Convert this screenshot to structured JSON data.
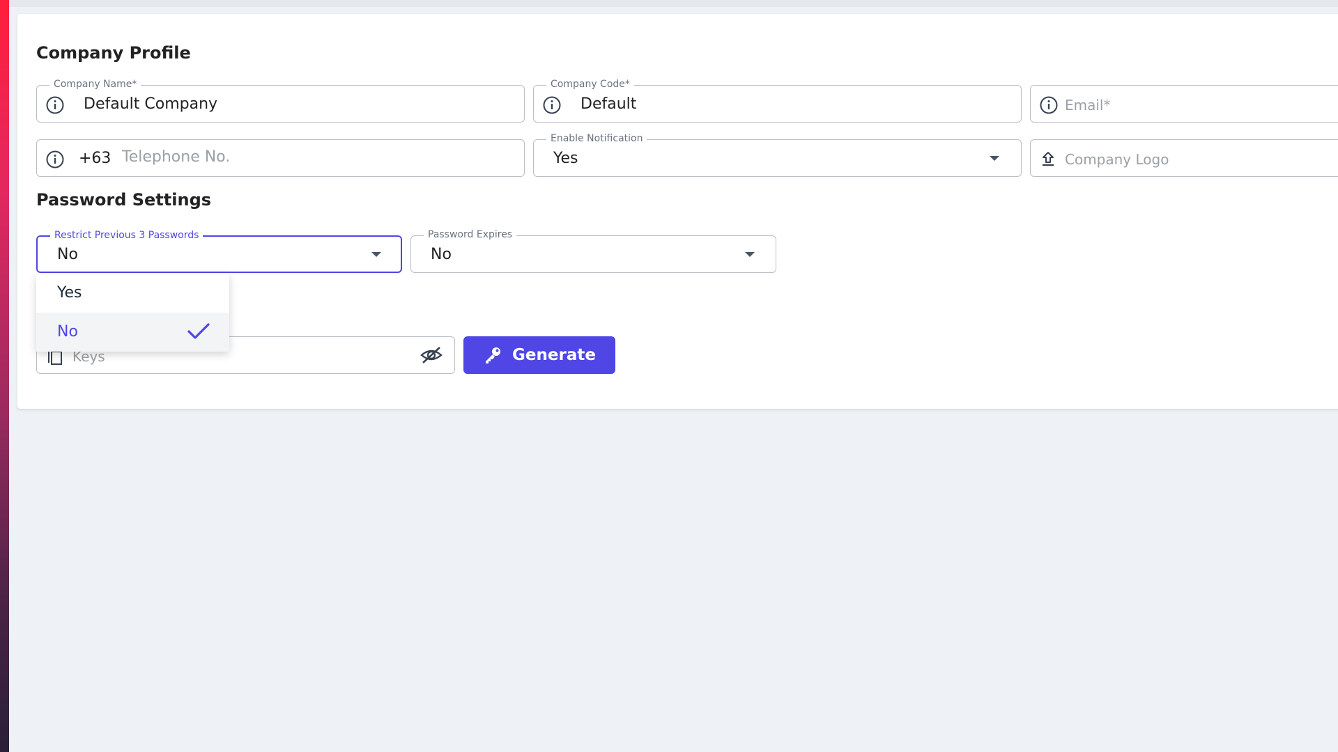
{
  "company_profile": {
    "title": "Company Profile",
    "company_name": {
      "label": "Company Name*",
      "value": "Default Company"
    },
    "company_code": {
      "label": "Company Code*",
      "value": "Default"
    },
    "email": {
      "placeholder": "Email*"
    },
    "telephone": {
      "prefix": "+63",
      "placeholder": "Telephone No."
    },
    "enable_notification": {
      "label": "Enable Notification",
      "value": "Yes"
    },
    "company_logo": {
      "placeholder": "Company Logo"
    }
  },
  "password_settings": {
    "title": "Password Settings",
    "restrict_previous": {
      "label": "Restrict Previous 3 Passwords",
      "value": "No"
    },
    "password_expires": {
      "label": "Password Expires",
      "value": "No"
    },
    "dropdown_options": [
      {
        "label": "Yes",
        "selected": false
      },
      {
        "label": "No",
        "selected": true
      }
    ],
    "keys": {
      "placeholder": "Keys"
    },
    "generate_label": "Generate"
  },
  "colors": {
    "accent": "#4f46e5",
    "border": "#b9bec7",
    "background": "#eef2f6"
  }
}
